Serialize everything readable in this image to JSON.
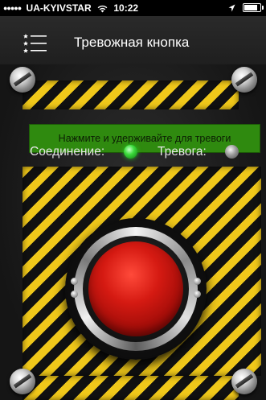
{
  "status_bar": {
    "signal_dots": "●●●●●",
    "carrier": "UA-KYIVSTAR",
    "time": "10:22",
    "icons": [
      "wifi-icon",
      "location-arrow-icon",
      "battery-icon"
    ],
    "battery_level": 0.85
  },
  "nav": {
    "title": "Тревожная кнопка",
    "menu_icon": "menu-list-icon"
  },
  "message": {
    "text": "Нажмите и удерживайте для тревоги"
  },
  "indicators": {
    "connection_label": "Соединение:",
    "connection_state": "on",
    "connection_color": "#3ddc3d",
    "alarm_label": "Тревога:",
    "alarm_state": "off",
    "alarm_color": "#9a9a9a"
  },
  "alarm_button": {
    "icon": "red-alarm-button",
    "color": "#d51a12"
  },
  "colors": {
    "hazard_yellow": "#f0c81a",
    "hazard_black": "#111111",
    "banner_green": "#2f8a0f"
  }
}
